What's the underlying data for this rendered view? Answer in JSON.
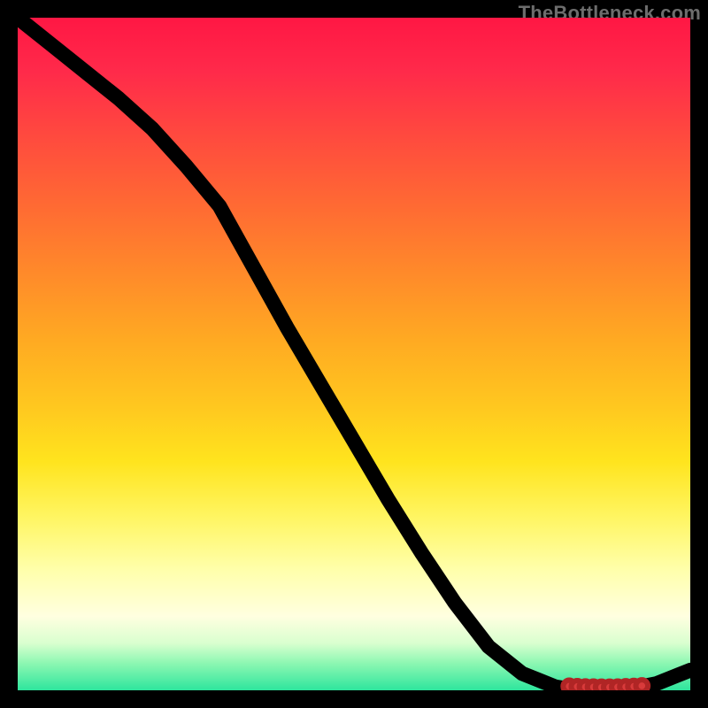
{
  "watermark": "TheBottleneck.com",
  "chart_data": {
    "type": "line",
    "title": "",
    "xlabel": "",
    "ylabel": "",
    "xlim": [
      0,
      100
    ],
    "ylim": [
      0,
      100
    ],
    "grid": false,
    "legend": false,
    "series": [
      {
        "name": "curve",
        "x": [
          0,
          5,
          10,
          15,
          20,
          25,
          30,
          35,
          40,
          45,
          50,
          55,
          60,
          65,
          70,
          75,
          80,
          82,
          84,
          86,
          88,
          90,
          92,
          95,
          100
        ],
        "values": [
          100,
          96,
          92,
          88,
          83.5,
          78,
          72,
          63,
          54,
          45.5,
          37,
          28.5,
          20.5,
          13,
          6.5,
          2.5,
          0.5,
          0.2,
          0.1,
          0.1,
          0.1,
          0.2,
          0.4,
          1.0,
          3.0
        ]
      }
    ],
    "markers": {
      "name": "highlight-cluster",
      "x": [
        82,
        83.2,
        84.4,
        85.6,
        86.8,
        88,
        89.2,
        90.4,
        91.6,
        92.8
      ],
      "values": [
        0.6,
        0.55,
        0.5,
        0.48,
        0.46,
        0.46,
        0.48,
        0.52,
        0.58,
        0.66
      ]
    }
  }
}
